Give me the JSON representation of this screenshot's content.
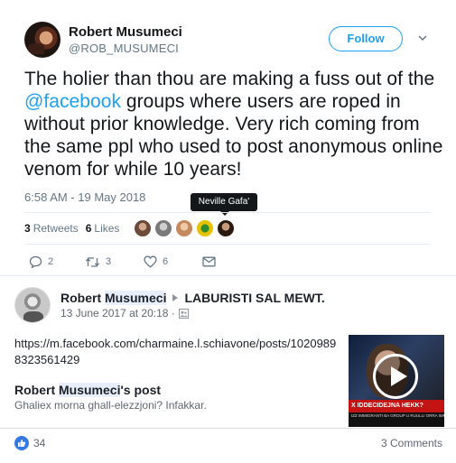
{
  "tweet": {
    "author": {
      "name": "Robert Musumeci",
      "handle": "@ROB_MUSUMECI"
    },
    "follow_label": "Follow",
    "text_before_mention": "The holier than thou are making a fuss out of the ",
    "mention": "@facebook",
    "text_after_mention": " groups where users are roped in without prior knowledge. Very rich coming from the same ppl who used to post anonymous online venom for while 10 years!",
    "timestamp": "6:58 AM - 19 May 2018",
    "tooltip": "Neville Gafa'",
    "retweets_count": "3",
    "retweets_label": "Retweets",
    "likes_count": "6",
    "likes_label": "Likes",
    "likers": [
      {
        "color": "#6b4a3a"
      },
      {
        "color": "#7a7a7a"
      },
      {
        "color": "#c48a5e"
      },
      {
        "color": "#e6c200"
      },
      {
        "color": "#2b1a12"
      }
    ],
    "actions": {
      "reply_count": "2",
      "retweet_count": "3",
      "like_count": "6"
    },
    "colors": {
      "accent": "#1da1f2",
      "muted": "#657786",
      "text": "#14171a"
    }
  },
  "facebook_post": {
    "author_first": "Robert ",
    "author_last": "Musumeci",
    "group": "LABURISTI SAL MEWT.",
    "date": "13 June 2017 at 20:18 ·",
    "link": "https://m.facebook.com/charmaine.l.schiavone/posts/10209898323561429",
    "shared_post_name_first": "Robert ",
    "shared_post_name_last": "Musumeci",
    "shared_post_suffix": "'s post",
    "shared_post_text": "Ghaliex morna ghall-elezzjoni? Infakkar.",
    "video_banner": "X IDDECIDEJNA HEKK?",
    "video_ticker": "IZZ IMMIGRANTI BA GROUP U RUULLI ORRA IMMIGRANTI ORRA",
    "likes": "34",
    "comments": "3 Comments",
    "colors": {
      "like_blue": "#3578e5",
      "highlight": "#e8eefa"
    }
  }
}
